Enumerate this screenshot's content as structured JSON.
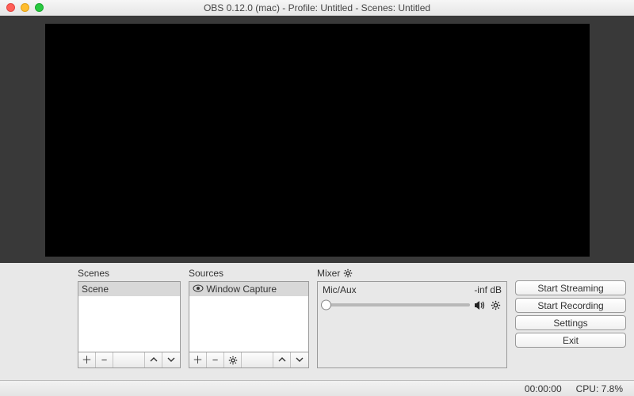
{
  "window": {
    "title": "OBS 0.12.0 (mac) - Profile: Untitled - Scenes: Untitled"
  },
  "scenes": {
    "label": "Scenes",
    "items": [
      {
        "name": "Scene",
        "selected": true
      }
    ]
  },
  "sources": {
    "label": "Sources",
    "items": [
      {
        "name": "Window Capture",
        "visible": true,
        "selected": true
      }
    ]
  },
  "mixer": {
    "label": "Mixer",
    "channel": {
      "name": "Mic/Aux",
      "level": "-inf dB"
    }
  },
  "buttons": {
    "start_streaming": "Start Streaming",
    "start_recording": "Start Recording",
    "settings": "Settings",
    "exit": "Exit"
  },
  "status": {
    "time": "00:00:00",
    "cpu": "CPU: 7.8%"
  }
}
